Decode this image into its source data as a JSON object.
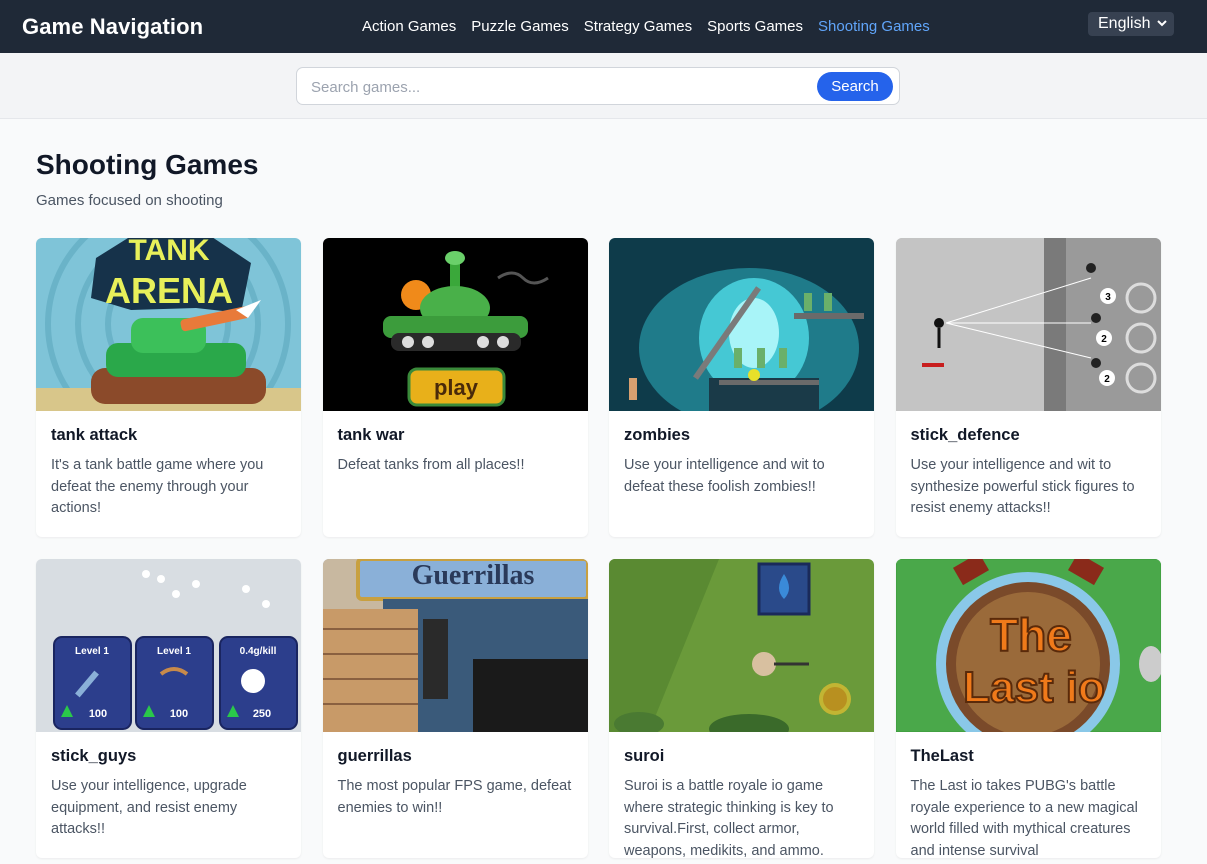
{
  "header": {
    "brand": "Game Navigation",
    "nav": [
      {
        "label": "Action Games",
        "active": false
      },
      {
        "label": "Puzzle Games",
        "active": false
      },
      {
        "label": "Strategy Games",
        "active": false
      },
      {
        "label": "Sports Games",
        "active": false
      },
      {
        "label": "Shooting Games",
        "active": true
      }
    ],
    "language": "English"
  },
  "search": {
    "placeholder": "Search games...",
    "button_label": "Search"
  },
  "category": {
    "title": "Shooting Games",
    "description": "Games focused on shooting"
  },
  "games": [
    {
      "title": "tank attack",
      "description": "It's a tank battle game where you defeat the enemy through your actions!",
      "thumb_text": "TANK ARENA"
    },
    {
      "title": "tank war",
      "description": "Defeat tanks from all places!!",
      "thumb_text": "play"
    },
    {
      "title": "zombies",
      "description": "Use your intelligence and wit to defeat these foolish zombies!!"
    },
    {
      "title": "stick_defence",
      "description": "Use your intelligence and wit to synthesize powerful stick figures to resist enemy attacks!!"
    },
    {
      "title": "stick_guys",
      "description": "Use your intelligence, upgrade equipment, and resist enemy attacks!!",
      "thumb_text": [
        "Level 1",
        "Level 1",
        "0.4g/kill",
        "100",
        "100",
        "250"
      ]
    },
    {
      "title": "guerrillas",
      "description": "The most popular FPS game, defeat enemies to win!!",
      "thumb_text": "Guerrillas IO"
    },
    {
      "title": "suroi",
      "description": "Suroi is a battle royale io game where strategic thinking is key to survival.First, collect armor, weapons, medikits, and ammo."
    },
    {
      "title": "TheLast",
      "description": "The Last io takes PUBG's battle royale experience to a new magical world filled with mythical creatures and intense survival",
      "thumb_text": "The Last io"
    }
  ],
  "colors": {
    "header_bg": "#1f2937",
    "accent": "#2563eb",
    "active_nav": "#60a5fa"
  }
}
